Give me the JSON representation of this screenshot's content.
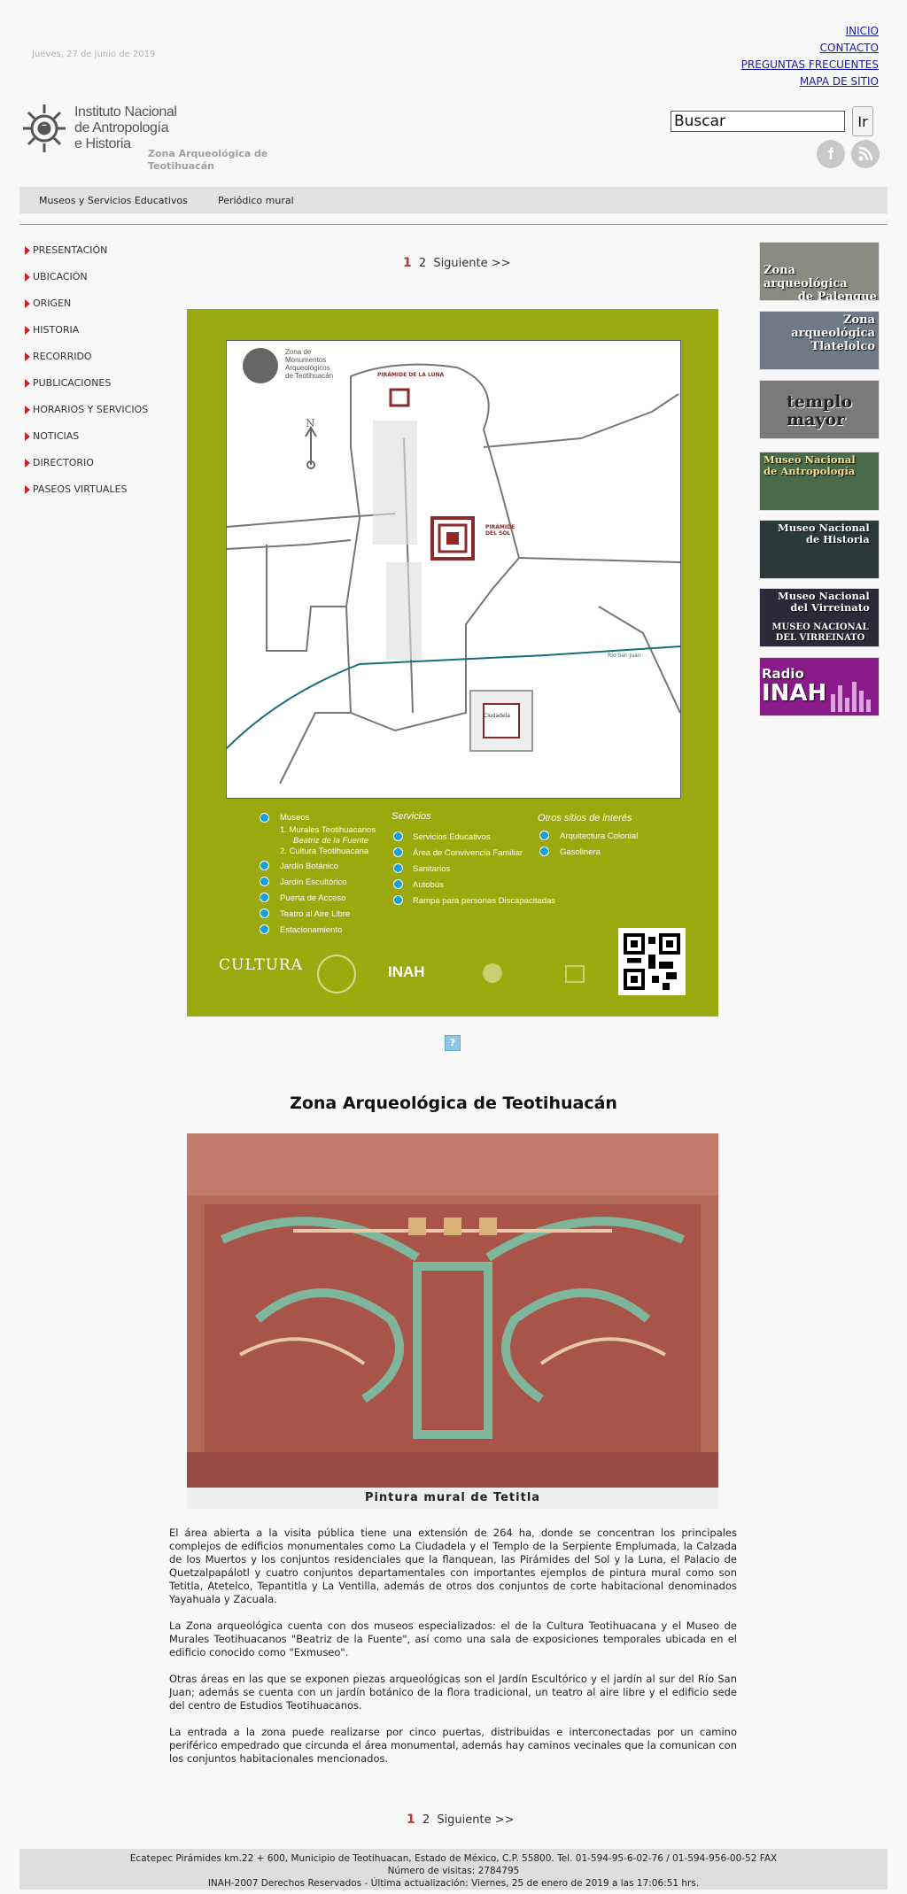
{
  "header": {
    "date": "Jueves, 27 de junio de 2019",
    "top_links": [
      "INICIO",
      "CONTACTO",
      "PREGUNTAS FRECUENTES",
      "MAPA DE SITIO"
    ],
    "logo_text_1": "Instituto Nacional",
    "logo_text_2": "de Antropología",
    "logo_text_3": "e Historia",
    "site_subtitle": "Zona Arqueológica de Teotihuacán",
    "search_value": "Buscar",
    "search_button": "Ir",
    "social": [
      "f",
      ")"
    ]
  },
  "menubar": [
    "Museos y Servicios Educativos",
    "Periódico mural"
  ],
  "leftnav": [
    "PRESENTACIÓN",
    "UBICACIÓN",
    "ORIGEN",
    "HISTORIA",
    "RECORRIDO",
    "PUBLICACIONES",
    "HORARIOS Y SERVICIOS",
    "NOTICIAS",
    "DIRECTORIO",
    "PASEOS VIRTUALES"
  ],
  "pager": {
    "current": "1",
    "next_page": "2",
    "next_label": "Siguiente >>"
  },
  "map": {
    "title_lines": [
      "Zona de",
      "Monumentos",
      "Arqueológicos",
      "de Teotihuacán"
    ],
    "north": "N",
    "places": [
      "PIRÁMIDE DE LA LUNA",
      "PIRÁMIDE DEL SOL",
      "Ciudadela",
      "Río San Juan"
    ],
    "legend_museos_title": "Museos",
    "legend_museos": [
      "1. Murales Teotihuacanos",
      "Beatriz de la Fuente",
      "2. Cultura Teotihuacana",
      "Jardín Botánico",
      "Jardín Escultórico",
      "Puerta de Acceso",
      "Teatro al Aire Libre",
      "Estacionamiento"
    ],
    "legend_servicios_title": "Servicios",
    "legend_servicios": [
      "Servicios Educativos",
      "Área de Convivencia Familiar",
      "Sanitarios",
      "Autobús",
      "Rampa para personas Discapacitadas"
    ],
    "legend_otros_title": "Otros sitios de interés",
    "legend_otros": [
      "Arquitectura Colonial",
      "Gasolinera"
    ],
    "logos": [
      "CULTURA",
      "INAH"
    ],
    "help_label": "?"
  },
  "main": {
    "title": "Zona Arqueológica de Teotihuacán",
    "image_caption": "Pintura mural de Tetitla",
    "paragraphs": [
      "El área abierta a la visita pública tiene una extensión de 264 ha, donde se concentran los principales complejos de edificios monumentales como La Ciudadela y el Templo de la Serpiente Emplumada, la Calzada de los Muertos y los conjuntos residenciales que la flanquean, las Pirámides del Sol y la Luna, el Palacio de Quetzalpapálotl y cuatro conjuntos departamentales con importantes ejemplos de pintura mural como son Tetitla, Atetelco, Tepantitla y La Ventilla, además de otros dos conjuntos de corte habitacional denominados Yayahuala y Zacuala.",
      "La Zona arqueológica cuenta con dos museos especializados: el de la Cultura Teotihuacana y el Museo de Murales Teotihuacanos \"Beatriz de la Fuente\", así como una sala de exposiciones temporales ubicada en el edificio conocido como \"Exmuseo\".",
      "Otras áreas en las que se exponen piezas arqueológicas son el Jardín Escultórico y el jardín al sur del Río San Juan; además se cuenta con un jardín botánico de la flora tradicional, un teatro al aire libre y el edificio sede del centro de Estudios Teotihuacanos.",
      "La entrada a la zona puede realizarse por cinco puertas, distribuidas e interconectadas por un camino periférico empedrado que circunda el área monumental, además hay caminos vecinales que la comunican con los conjuntos habitacionales mencionados."
    ]
  },
  "banners": [
    {
      "label_1": "Zona",
      "label_2": "arqueológica",
      "label_3": "de Palenque",
      "bg": "#8a8a80"
    },
    {
      "label_1": "Zona",
      "label_2": "arqueológica",
      "label_3": "Tlatelolco",
      "bg": "#6f7a88"
    },
    {
      "label_1": "templo",
      "label_2": "mayor",
      "label_3": "",
      "bg": "#7a7a7a"
    },
    {
      "label_1": "Museo Nacional",
      "label_2": "de Antropología",
      "label_3": "",
      "bg": "#4a6a4a"
    },
    {
      "label_1": "Museo Nacional",
      "label_2": "de Historia",
      "label_3": "",
      "bg": "#2a3a3a"
    },
    {
      "label_1": "Museo Nacional",
      "label_2": "del Virreinato",
      "label_3": "MUSEO NACIONAL DEL VIRREINATO",
      "bg": "#2a2a3a"
    },
    {
      "label_1": "Radio",
      "label_2": "INAH",
      "label_3": "",
      "bg": "#8a1a8a"
    }
  ],
  "footer": {
    "line_1": "Ecatepec Pirámides km.22 + 600, Municipio de Teotihuacan, Estado de México, C.P. 55800. Tel. 01-594-95-6-02-76 / 01-594-956-00-52 FAX",
    "line_2": "Número de visitas: 2784795",
    "line_3": "INAH-2007 Derechos Reservados -  Última actualización: Viernes, 25 de enero de 2019 a las 17:06:51 hrs."
  },
  "colors": {
    "map_bg": "#9aaa0e",
    "nav_bullet": "#cc2222",
    "link": "#1a1aa6",
    "map_icon": "#1aa0d6"
  }
}
